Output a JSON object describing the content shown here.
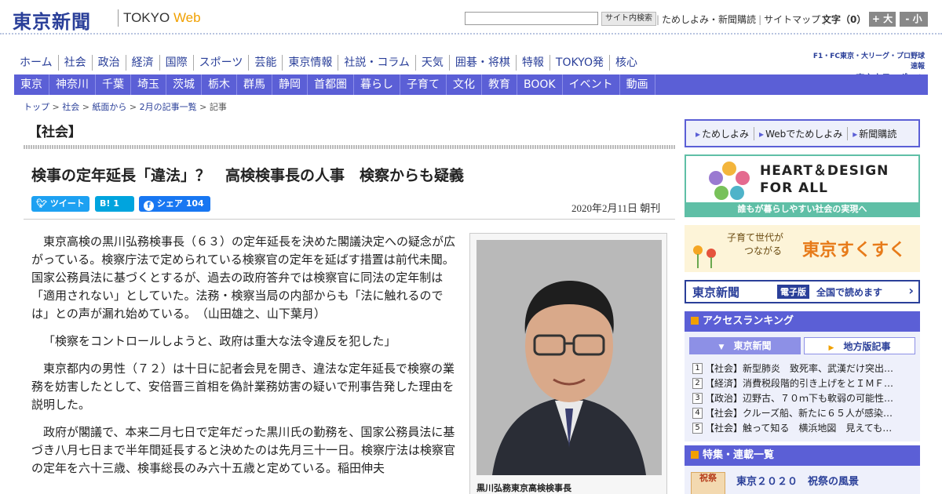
{
  "header": {
    "logo": "東京新聞",
    "logo_tokyo": "TOKYO ",
    "logo_web": "Web",
    "search_button": "サイト内検索",
    "links": [
      "ためしよみ・新聞購読",
      "サイトマップ"
    ],
    "font_label": "文字（0）",
    "font_up": "+ 大",
    "font_down": "- 小"
  },
  "nav_main": [
    "ホーム",
    "社会",
    "政治",
    "経済",
    "国際",
    "スポーツ",
    "芸能",
    "東京情報",
    "社説・コラム",
    "天気",
    "囲碁・将棋",
    "特報",
    "TOKYO発",
    "核心"
  ],
  "chunichi": {
    "line1": "F1・FC東京・大リーグ・プロ野球速報",
    "line2": "東京中日スポーツ"
  },
  "nav_regional": [
    "東京",
    "神奈川",
    "千葉",
    "埼玉",
    "茨城",
    "栃木",
    "群馬",
    "静岡",
    "首都圏",
    "暮らし",
    "子育て",
    "文化",
    "教育",
    "BOOK",
    "イベント",
    "動画"
  ],
  "breadcrumb": [
    "トップ",
    "社会",
    "紙面から",
    "2月の記事一覧",
    "記事"
  ],
  "article": {
    "section": "【社会】",
    "headline": "検事の定年延長「違法」？　高検検事長の人事　検察からも疑義",
    "tweet_label": "ツイート",
    "hatena_label": "B!",
    "hatena_count": "1",
    "share_label": "シェア",
    "share_count": "104",
    "date": "2020年2月11日 朝刊",
    "paragraphs": [
      "東京高検の黒川弘務検事長（６３）の定年延長を決めた閣議決定への疑念が広がっている。検察庁法で定められている検察官の定年を延ばす措置は前代未聞。国家公務員法に基づくとするが、過去の政府答弁では検察官に同法の定年制は「適用されない」としていた。法務・検察当局の内部からも「法に触れるのでは」との声が漏れ始めている。　（山田雄之、山下葉月）",
      "「検察をコントロールしようと、政府は重大な法令違反を犯した」",
      "東京都内の男性（７２）は十日に記者会見を開き、違法な定年延長で検察の業務を妨害したとして、安倍晋三首相を偽計業務妨害の疑いで刑事告発した理由を説明した。",
      "政府が閣議で、本来二月七日で定年だった黒川氏の勤務を、国家公務員法に基づき八月七日まで半年間延長すると決めたのは先月三十一日。検察庁法は検察官の定年を六十三歳、検事総長のみ六十五歳と定めている。稲田伸夫"
    ],
    "photo_caption": "黒川弘務東京高検検事長"
  },
  "sidebar": {
    "promo": [
      "ためしよみ",
      "Webでためしよみ",
      "新聞購読"
    ],
    "heart_title_1": "HEART＆DESIGN",
    "heart_title_2": "FOR ALL",
    "heart_sub": "誰もが暮らしやすい社会の実現へ",
    "suku_small_1": "子育て世代が",
    "suku_small_2": "つながる",
    "suku_big": "東京すくすく",
    "eshi_logo": "東京新聞",
    "eshi_tag": "電子版",
    "eshi_text": "全国で読めます",
    "ranking_title": "アクセスランキング",
    "ranking_tab1": "東京新聞",
    "ranking_tab2": "地方版記事",
    "ranking": [
      "【社会】新型肺炎　致死率、武漢だけ突出…",
      "【経済】消費税段階的引き上げをとＩＭＦ…",
      "【政治】辺野古、７０ｍ下も軟弱の可能性…",
      "【社会】クルーズ船、新たに６５人が感染…",
      "【社会】触って知る　横浜地図　見えても…"
    ],
    "feature_title": "特集・連載一覧",
    "feature_thumb": "祝祭",
    "feature_text": "東京２０２０　祝祭の風景"
  },
  "colors": {
    "brand": "#2a3f99",
    "nav": "#5b5fd6",
    "accent": "#f0a000",
    "twitter": "#1da1f2",
    "hatena": "#00a4de",
    "facebook": "#1877f2"
  }
}
